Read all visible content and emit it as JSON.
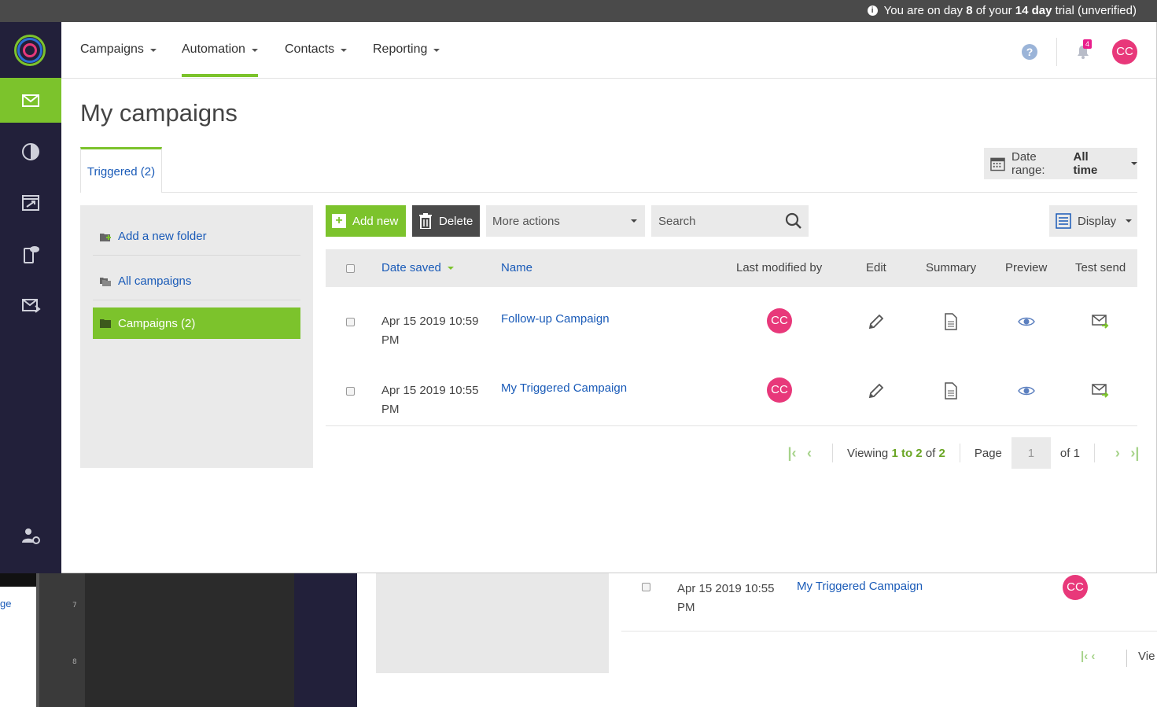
{
  "trial_banner": {
    "prefix": "You are on day",
    "day": "8",
    "middle": "of your",
    "length": "14 day",
    "suffix": "trial (unverified)"
  },
  "nav": {
    "items": [
      {
        "label": "Campaigns"
      },
      {
        "label": "Automation"
      },
      {
        "label": "Contacts"
      },
      {
        "label": "Reporting"
      }
    ],
    "notification_count": "4",
    "user_initials": "CC"
  },
  "page": {
    "title": "My campaigns",
    "tab_label": "Triggered (2)",
    "date_range_label": "Date range:",
    "date_range_value": "All time"
  },
  "folders": {
    "add_folder": "Add a new folder",
    "all_campaigns": "All campaigns",
    "campaigns": "Campaigns (2)"
  },
  "toolbar": {
    "add_new": "Add new",
    "delete": "Delete",
    "more_actions": "More actions",
    "search_placeholder": "Search",
    "display": "Display"
  },
  "table": {
    "headers": {
      "date_saved": "Date saved",
      "name": "Name",
      "last_modified_by": "Last modified by",
      "edit": "Edit",
      "summary": "Summary",
      "preview": "Preview",
      "test_send": "Test send"
    },
    "rows": [
      {
        "date": "Apr 15 2019 10:59 PM",
        "name": "Follow-up Campaign",
        "modified_by": "CC"
      },
      {
        "date": "Apr 15 2019 10:55 PM",
        "name": "My Triggered Campaign",
        "modified_by": "CC"
      }
    ]
  },
  "pager": {
    "viewing": "Viewing",
    "range_start": "1",
    "to": "to",
    "range_end": "2",
    "of": "of",
    "total": "2",
    "page_label": "Page",
    "page_value": "1",
    "of_pages": "of 1"
  },
  "background": {
    "left_text": "ge",
    "ruler_7": "7",
    "ruler_8": "8",
    "row_date": "Apr 15 2019 10:55 PM",
    "row_name": "My Triggered Campaign",
    "row_initials": "CC",
    "view_text": "Vie"
  },
  "colors": {
    "accent_green": "#7cc32c",
    "sidebar_navy": "#22203a",
    "link_blue": "#1a5bb8",
    "avatar_pink": "#e8387a"
  }
}
